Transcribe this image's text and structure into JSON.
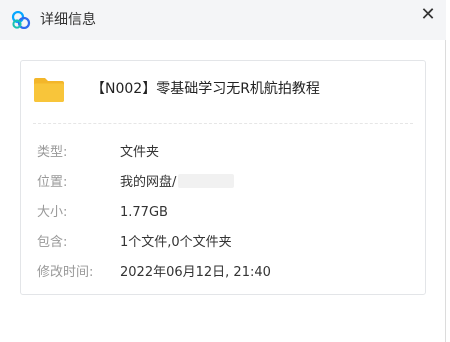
{
  "window": {
    "title": "详细信息",
    "close_label": "✕"
  },
  "file": {
    "name": "【N002】零基础学习无R机航拍教程",
    "icon": "folder-icon"
  },
  "details": [
    {
      "label": "类型:",
      "value": "文件夹"
    },
    {
      "label": "位置:",
      "value": "我的网盘/"
    },
    {
      "label": "大小:",
      "value": "1.77GB"
    },
    {
      "label": "包含:",
      "value": "1个文件,0个文件夹"
    },
    {
      "label": "修改时间:",
      "value": "2022年06月12日, 21:40"
    }
  ],
  "colors": {
    "titlebar": "#f4f5f7",
    "folder": "#f8c53a",
    "label": "#999999",
    "value": "#333333"
  }
}
